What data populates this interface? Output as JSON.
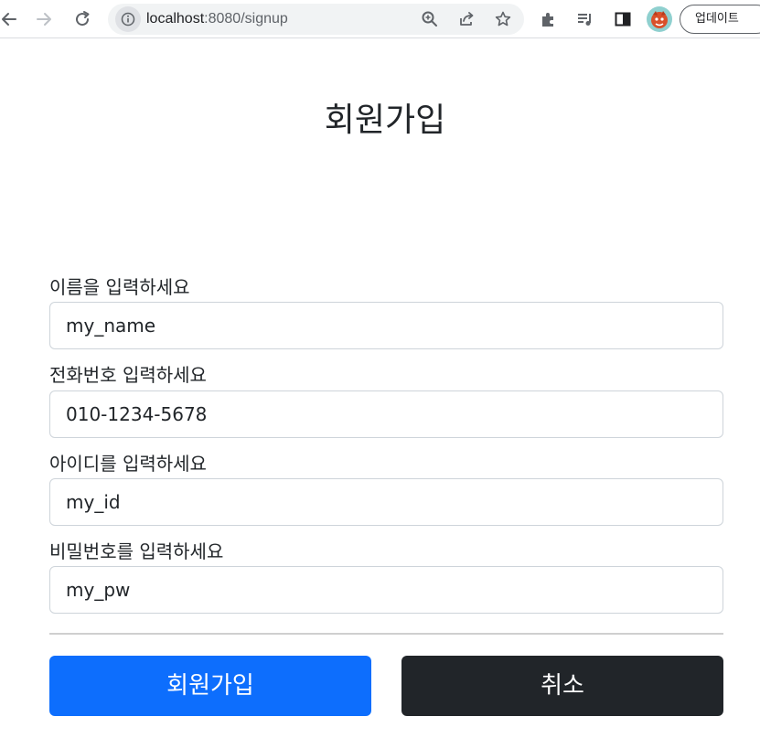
{
  "browser": {
    "url_host": "localhost",
    "url_path": ":8080/signup",
    "update_label": "업데이트",
    "icons": [
      "back-icon",
      "forward-icon",
      "reload-icon",
      "site-info-icon",
      "zoom-icon",
      "share-icon",
      "bookmark-star-icon",
      "extensions-icon",
      "media-control-icon",
      "side-panel-icon",
      "profile-avatar"
    ]
  },
  "page": {
    "title": "회원가입"
  },
  "form": {
    "fields": [
      {
        "label": "이름을 입력하세요",
        "value": "my_name"
      },
      {
        "label": "전화번호 입력하세요",
        "value": "010-1234-5678"
      },
      {
        "label": "아이디를 입력하세요",
        "value": "my_id"
      },
      {
        "label": "비밀번호를 입력하세요",
        "value": "my_pw"
      }
    ],
    "submit_label": "회원가입",
    "cancel_label": "취소"
  },
  "colors": {
    "primary": "#0d6efd",
    "dark": "#212529",
    "input_border": "#ced4da"
  }
}
